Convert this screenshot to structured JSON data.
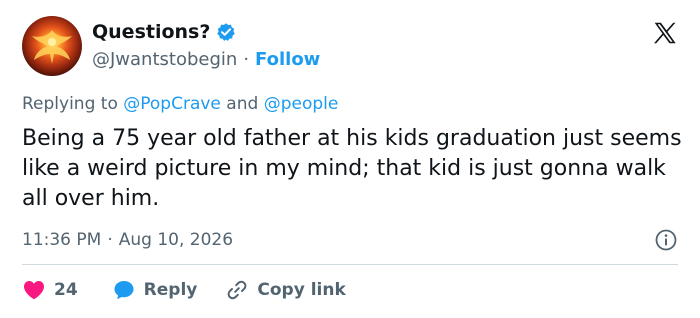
{
  "author": {
    "display_name": "Questions?",
    "handle": "@Jwantstobegin",
    "separator": "·",
    "follow_label": "Follow",
    "verified_color": "#1d9bf0"
  },
  "reply_context": {
    "prefix": "Replying to",
    "mention_1": "@PopCrave",
    "conjunction": "and",
    "mention_2": "@people"
  },
  "tweet": {
    "text": "Being a 75 year old father at his kids graduation just seems like a weird picture in my mind; that kid is just gonna walk all over him.",
    "time": "11:36 PM",
    "separator": "·",
    "date": "Aug 10, 2026"
  },
  "actions": {
    "like_count": "24",
    "reply_label": "Reply",
    "copy_link_label": "Copy link"
  },
  "colors": {
    "accent": "#1d9bf0",
    "like": "#f91880",
    "muted": "#536471",
    "text": "#0f1419"
  },
  "icons": [
    "verified-badge-icon",
    "x-logo-icon",
    "info-icon",
    "heart-icon",
    "reply-bubble-icon",
    "link-icon"
  ]
}
